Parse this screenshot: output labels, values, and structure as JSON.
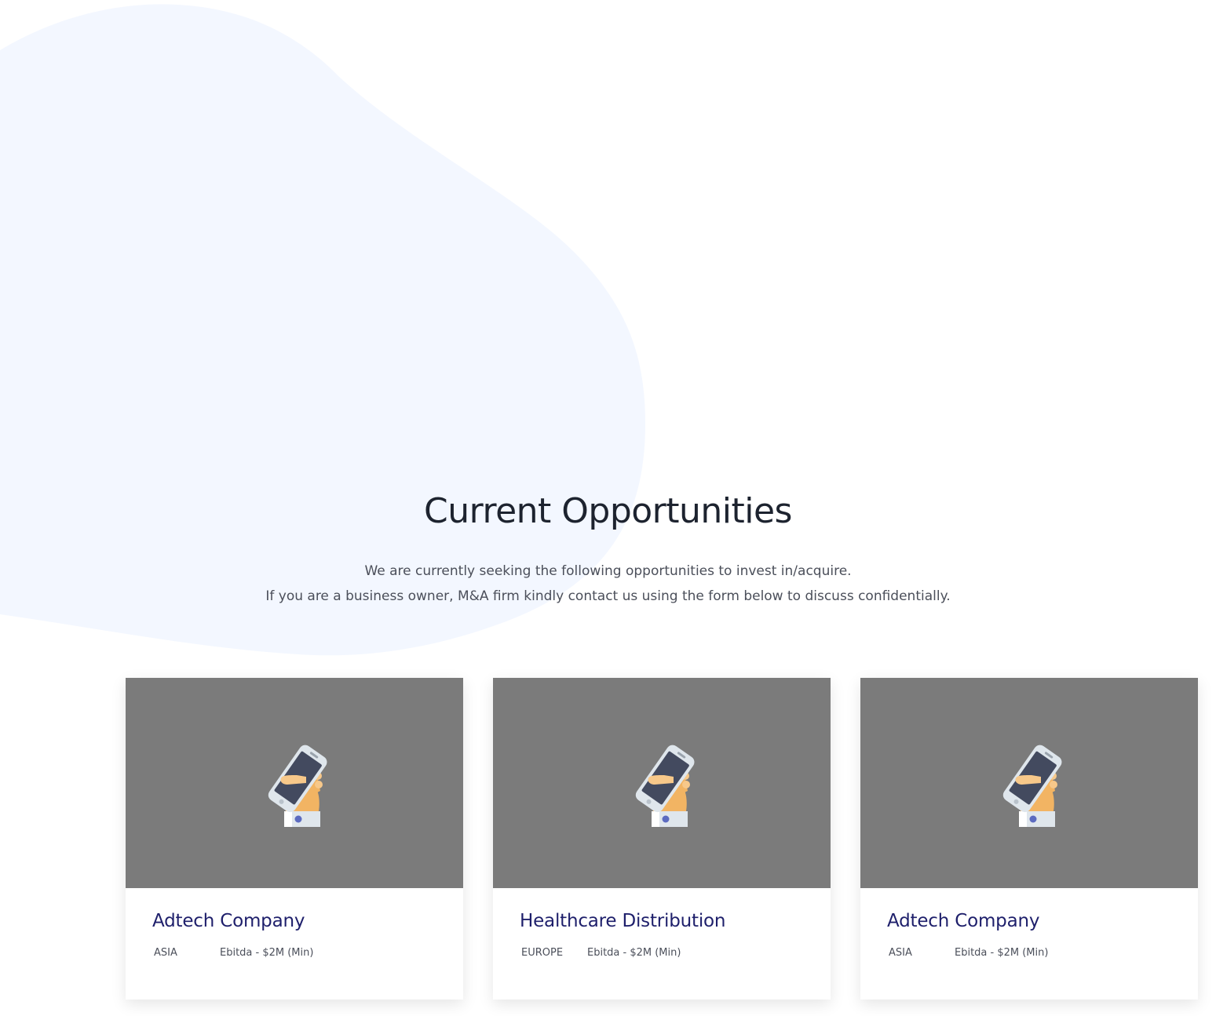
{
  "colors": {
    "background": "#ffffff",
    "blob": "#f3f7ff",
    "title": "#1d232f",
    "subtitle": "#4b4f5a",
    "card_title": "#1e1f6b",
    "card_image_bg": "#7b7b7b"
  },
  "section": {
    "title": "Current Opportunities",
    "subtitle_line1": "We are currently seeking the following opportunities to invest in/acquire.",
    "subtitle_line2": "If you are a business owner, M&A firm kindly contact us using the form below to discuss confidentially."
  },
  "cards": [
    {
      "icon": "hand-holding-phone-icon",
      "title": "Adtech Company",
      "region": "ASIA",
      "ebitda": "Ebitda - $2M (Min)"
    },
    {
      "icon": "hand-holding-phone-icon",
      "title": "Healthcare Distribution",
      "region": "EUROPE",
      "ebitda": "Ebitda - $2M (Min)"
    },
    {
      "icon": "hand-holding-phone-icon",
      "title": "Adtech Company",
      "region": "ASIA",
      "ebitda": "Ebitda - $2M (Min)"
    }
  ]
}
